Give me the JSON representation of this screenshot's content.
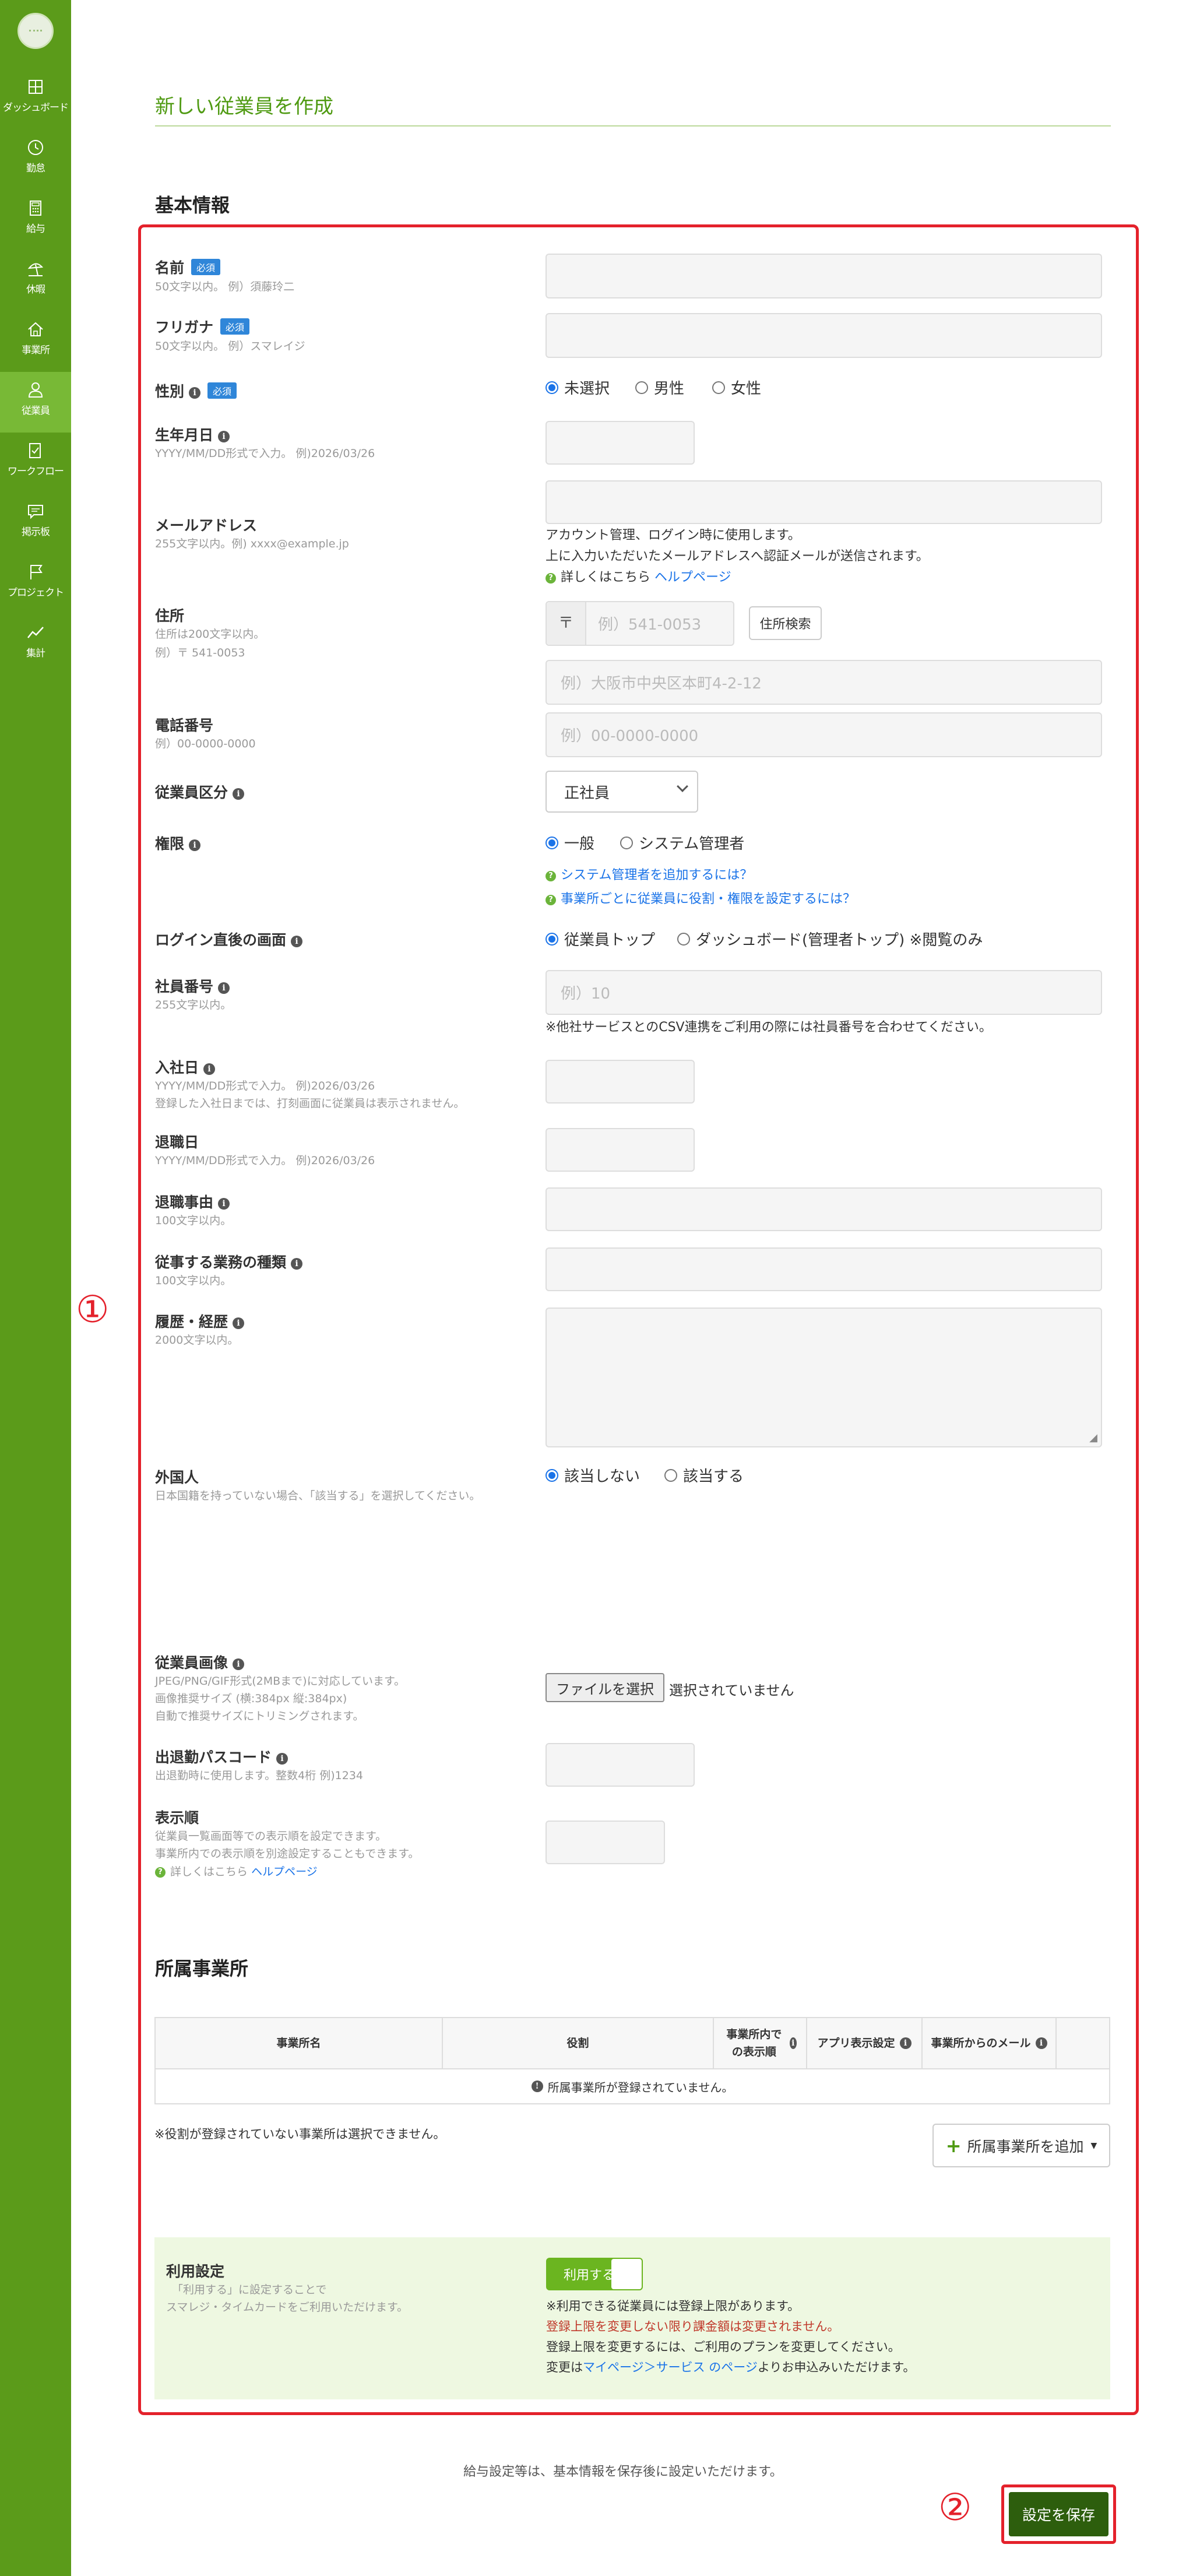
{
  "sidebar": {
    "items": [
      {
        "label": "ダッシュボード",
        "icon": "dashboard-icon"
      },
      {
        "label": "勤怠",
        "icon": "clock-icon"
      },
      {
        "label": "給与",
        "icon": "calculator-icon"
      },
      {
        "label": "休暇",
        "icon": "beach-icon"
      },
      {
        "label": "事業所",
        "icon": "home-icon"
      },
      {
        "label": "従業員",
        "icon": "person-icon"
      },
      {
        "label": "ワークフロー",
        "icon": "workflow-icon"
      },
      {
        "label": "掲示板",
        "icon": "chat-icon"
      },
      {
        "label": "プロジェクト",
        "icon": "flag-icon"
      },
      {
        "label": "集計",
        "icon": "chart-icon"
      }
    ],
    "active": "従業員"
  },
  "page": {
    "title": "新しい従業員を作成"
  },
  "basic": {
    "section_title": "基本情報",
    "marker": "①",
    "required": "必須",
    "name": {
      "label": "名前",
      "hint": "50文字以内。 例）須藤玲二"
    },
    "kana": {
      "label": "フリガナ",
      "hint": "50文字以内。 例）スマレイジ"
    },
    "gender": {
      "label": "性別",
      "options": [
        "未選択",
        "男性",
        "女性"
      ],
      "selected": "未選択"
    },
    "birthday": {
      "label": "生年月日",
      "hint": "YYYY/MM/DD形式で入力。 例)2026/03/26"
    },
    "email": {
      "label": "メールアドレス",
      "hint": "255文字以内。例) xxxx@example.jp",
      "note1": "アカウント管理、ログイン時に使用します。",
      "note2": "上に入力いただいたメールアドレスへ認証メールが送信されます。",
      "help_prefix": "詳しくはこちら",
      "help_link": "ヘルプページ"
    },
    "address": {
      "label": "住所",
      "hint1": "住所は200文字以内。",
      "hint2": "例）〒 541-0053",
      "zip_mark": "〒",
      "zip_placeholder": "例）541-0053",
      "search_button": "住所検索",
      "address_placeholder": "例）大阪市中央区本町4-2-12"
    },
    "phone": {
      "label": "電話番号",
      "hint": "例）00-0000-0000",
      "placeholder": "例）00-0000-0000"
    },
    "category": {
      "label": "従業員区分",
      "value": "正社員"
    },
    "permission": {
      "label": "権限",
      "options": [
        "一般",
        "システム管理者"
      ],
      "selected": "一般",
      "help1": "システム管理者を追加するには？",
      "help2": "事業所ごとに従業員に役割・権限を設定するには？"
    },
    "login_screen": {
      "label": "ログイン直後の画面",
      "options": [
        "従業員トップ",
        "ダッシュボード(管理者トップ) ※閲覧のみ"
      ],
      "selected": "従業員トップ"
    },
    "employee_no": {
      "label": "社員番号",
      "hint": "255文字以内。",
      "placeholder": "例）10",
      "note": "※他社サービスとのCSV連携をご利用の際には社員番号を合わせてください。"
    },
    "join_date": {
      "label": "入社日",
      "hint1": "YYYY/MM/DD形式で入力。 例)2026/03/26",
      "hint2": "登録した入社日までは、打刻画面に従業員は表示されません。"
    },
    "leave_date": {
      "label": "退職日",
      "hint": "YYYY/MM/DD形式で入力。 例)2026/03/26"
    },
    "leave_reason": {
      "label": "退職事由",
      "hint": "100文字以内。"
    },
    "job_type": {
      "label": "従事する業務の種類",
      "hint": "100文字以内。"
    },
    "history": {
      "label": "履歴・経歴",
      "hint": "2000文字以内。"
    },
    "foreigner": {
      "label": "外国人",
      "hint": "日本国籍を持っていない場合、「該当する」を選択してください。",
      "options": [
        "該当しない",
        "該当する"
      ],
      "selected": "該当しない"
    },
    "photo": {
      "label": "従業員画像",
      "hint1": "JPEG/PNG/GIF形式(2MBまで)に対応しています。",
      "hint2": "画像推奨サイズ (横:384px 縦:384px)",
      "hint3": "自動で推奨サイズにトリミングされます。",
      "file_button": "ファイルを選択",
      "file_status": "選択されていません"
    },
    "passcode": {
      "label": "出退勤パスコード",
      "hint": "出退勤時に使用します。整数4桁 例)1234"
    },
    "order": {
      "label": "表示順",
      "hint1": "従業員一覧画面等での表示順を設定できます。",
      "hint2": "事業所内での表示順を別途設定することもできます。",
      "help_prefix": "詳しくはこちら",
      "help_link": "ヘルプページ"
    }
  },
  "stores": {
    "section_title": "所属事業所",
    "columns": [
      "事業所名",
      "役割",
      "事業所内での表示順",
      "アプリ表示設定",
      "事業所からのメール"
    ],
    "empty": "所属事業所が登録されていません。",
    "note": "※役割が登録されていない事業所は選択できません。",
    "add_button": "所属事業所を追加"
  },
  "usage": {
    "label": "利用設定",
    "hint1": "「利用する」に設定することで",
    "hint2": "スマレジ・タイムカードをご利用いただけます。",
    "toggle": "利用する",
    "note1": "※利用できる従業員には登録上限があります。",
    "note2": "登録上限を変更しない限り課金額は変更されません。",
    "note3": "登録上限を変更するには、ご利用のプランを変更してください。",
    "note4_pre": "変更は",
    "note4_link": "マイページ＞サービス のページ",
    "note4_post": "よりお申込みいただけます。"
  },
  "footer": {
    "note": "給与設定等は、基本情報を保存後に設定いただけます。",
    "marker": "②",
    "save_button": "設定を保存"
  },
  "colors": {
    "sidebar": "#5b9b1a",
    "accent": "#4f9a12",
    "highlight": "#e4212b",
    "save": "#2d5e0d"
  }
}
